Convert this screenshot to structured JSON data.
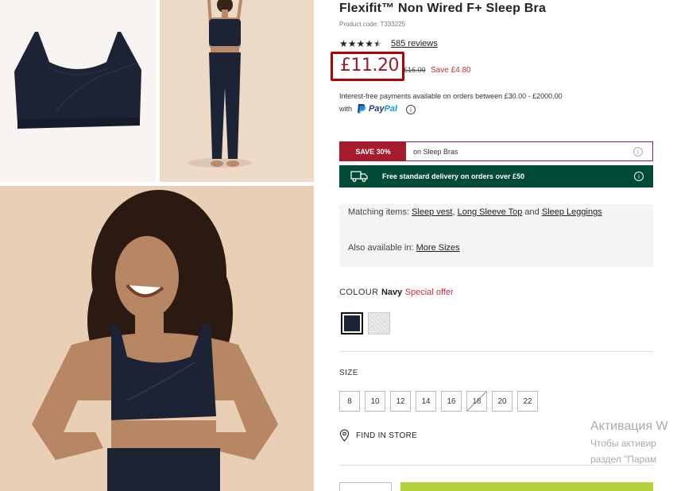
{
  "product": {
    "title": "Flexifit™ Non Wired F+ Sleep Bra",
    "product_code": "Product code: T333225",
    "rating_stars": 4.5,
    "reviews": "585 reviews",
    "price": "£11.20",
    "was_price": "£16.00",
    "save_text": "Save £4.80"
  },
  "payments": {
    "installments": "Interest-free payments available on orders between £30.00 - £2000.00",
    "with": "with",
    "paypal_p": "Pay",
    "paypal_pal": "Pal"
  },
  "promo": {
    "tag": "SAVE 30%",
    "text": "on Sleep Bras"
  },
  "delivery": {
    "text": "Free standard delivery on orders over £50"
  },
  "matching": {
    "prefix": "Matching items:",
    "item1": "Sleep vest",
    "sep1": ",",
    "item2": "Long Sleeve Top",
    "and": "and",
    "item3": "Sleep Leggings",
    "also_prefix": "Also available in:",
    "also_link": "More Sizes"
  },
  "colour": {
    "label": "COLOUR",
    "selected": "Navy",
    "offer": "Special offer",
    "swatches": [
      "navy-swatch",
      "grey-marl-swatch"
    ]
  },
  "size": {
    "label": "SIZE",
    "options": [
      "8",
      "10",
      "12",
      "14",
      "16",
      "18",
      "20",
      "22"
    ],
    "unavailable": [
      "18"
    ]
  },
  "store": {
    "label": "FIND IN STORE"
  },
  "windows_watermark": {
    "title": "Активация W",
    "line1": "Чтобы активир",
    "line2": "раздел \"Парам"
  },
  "colors": {
    "price_red": "#9b1b2b",
    "promo_red": "#a61b2e",
    "delivery_green": "#004b35",
    "add_to_bag_green": "#b3d13a",
    "navy": "#1c2438"
  },
  "icons": [
    "star-icon",
    "half-star-icon",
    "info-icon",
    "paypal-icon",
    "truck-icon",
    "map-pin-icon"
  ]
}
